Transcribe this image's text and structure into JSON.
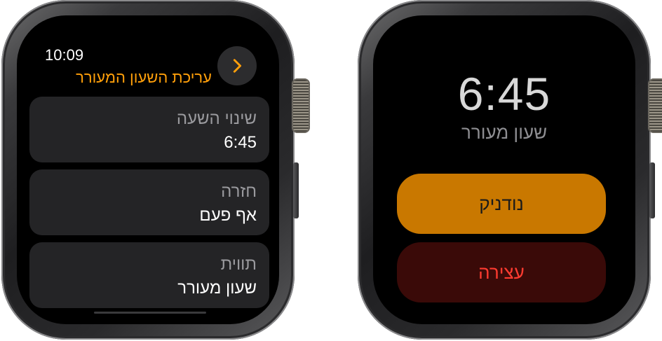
{
  "left_watch": {
    "status_time": "10:09",
    "title": "עריכת השעון המעורר",
    "back_icon": "chevron-right-icon",
    "rows": [
      {
        "label": "שינוי השעה",
        "value": "6:45"
      },
      {
        "label": "חזרה",
        "value": "אף פעם"
      },
      {
        "label": "תווית",
        "value": "שעון מעורר"
      }
    ]
  },
  "right_watch": {
    "alarm_time": "6:45",
    "alarm_label": "שעון מעורר",
    "snooze_label": "נודניק",
    "stop_label": "עצירה"
  },
  "colors": {
    "accent_orange": "#ff9f0a",
    "snooze_bg": "#c97800",
    "stop_bg": "#3a0a08",
    "stop_text": "#ff3b30"
  }
}
